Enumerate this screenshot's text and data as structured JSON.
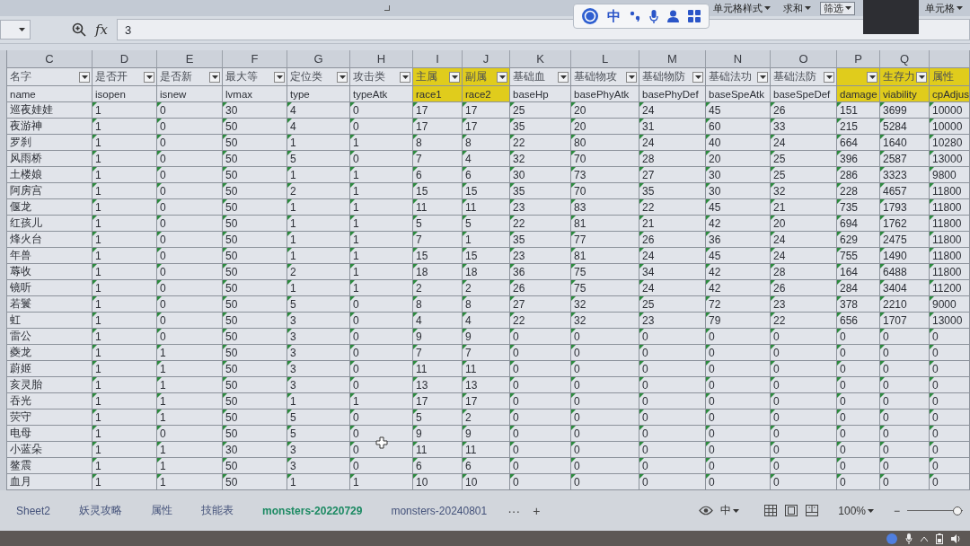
{
  "ribbon": {
    "buttons": [
      {
        "label": "单元格样式",
        "on": false
      },
      {
        "label": "求和",
        "on": false
      },
      {
        "label": "筛选",
        "on": true
      },
      {
        "label": "单元格",
        "on": false
      }
    ]
  },
  "ime_toolbar": {
    "mode": "中"
  },
  "formula_bar": {
    "fx": "fx",
    "value": "3"
  },
  "columns": [
    {
      "letter": "C",
      "title": "名字",
      "field": "name",
      "filter": true,
      "highlight": false,
      "number_as_text": false
    },
    {
      "letter": "D",
      "title": "是否开",
      "field": "isopen",
      "filter": true,
      "highlight": false,
      "number_as_text": true
    },
    {
      "letter": "E",
      "title": "是否新",
      "field": "isnew",
      "filter": true,
      "highlight": false,
      "number_as_text": true
    },
    {
      "letter": "F",
      "title": "最大等",
      "field": "lvmax",
      "filter": true,
      "highlight": false,
      "number_as_text": true
    },
    {
      "letter": "G",
      "title": "定位类",
      "field": "type",
      "filter": true,
      "highlight": false,
      "number_as_text": true
    },
    {
      "letter": "H",
      "title": "攻击类",
      "field": "typeAtk",
      "filter": true,
      "highlight": false,
      "number_as_text": true
    },
    {
      "letter": "I",
      "title": "主属",
      "field": "race1",
      "filter": true,
      "highlight": true,
      "number_as_text": true
    },
    {
      "letter": "J",
      "title": "副属",
      "field": "race2",
      "filter": true,
      "highlight": true,
      "number_as_text": true
    },
    {
      "letter": "K",
      "title": "基础血",
      "field": "baseHp",
      "filter": true,
      "highlight": false,
      "number_as_text": true
    },
    {
      "letter": "L",
      "title": "基础物攻",
      "field": "basePhyAtk",
      "filter": true,
      "highlight": false,
      "number_as_text": true
    },
    {
      "letter": "M",
      "title": "基础物防",
      "field": "basePhyDef",
      "filter": true,
      "highlight": false,
      "number_as_text": true
    },
    {
      "letter": "N",
      "title": "基础法功",
      "field": "baseSpeAtk",
      "filter": true,
      "highlight": false,
      "number_as_text": true
    },
    {
      "letter": "O",
      "title": "基础法防",
      "field": "baseSpeDef",
      "filter": true,
      "highlight": false,
      "number_as_text": true
    },
    {
      "letter": "P",
      "field": "damage",
      "filter": true,
      "highlight": true,
      "number_as_text": true
    },
    {
      "letter": "Q",
      "title": "生存力",
      "field": "viability",
      "filter": true,
      "highlight": true,
      "number_as_text": true
    },
    {
      "title": "属性",
      "field": "cpAdjus",
      "filter": false,
      "highlight": true,
      "number_as_text": true
    }
  ],
  "rows": [
    [
      "巡夜娃娃",
      "1",
      "0",
      "30",
      "4",
      "0",
      "17",
      "17",
      "25",
      "20",
      "24",
      "45",
      "26",
      "151",
      "3699",
      "10000"
    ],
    [
      "夜游神",
      "1",
      "0",
      "50",
      "4",
      "0",
      "17",
      "17",
      "35",
      "20",
      "31",
      "60",
      "33",
      "215",
      "5284",
      "10000"
    ],
    [
      "罗刹",
      "1",
      "0",
      "50",
      "1",
      "1",
      "8",
      "8",
      "22",
      "80",
      "24",
      "40",
      "24",
      "664",
      "1640",
      "10280"
    ],
    [
      "风雨桥",
      "1",
      "0",
      "50",
      "5",
      "0",
      "7",
      "4",
      "32",
      "70",
      "28",
      "20",
      "25",
      "396",
      "2587",
      "13000"
    ],
    [
      "土楼娘",
      "1",
      "0",
      "50",
      "1",
      "1",
      "6",
      "6",
      "30",
      "73",
      "27",
      "30",
      "25",
      "286",
      "3323",
      "9800"
    ],
    [
      "阿房宫",
      "1",
      "0",
      "50",
      "2",
      "1",
      "15",
      "15",
      "35",
      "70",
      "35",
      "30",
      "32",
      "228",
      "4657",
      "11800"
    ],
    [
      "偃龙",
      "1",
      "0",
      "50",
      "1",
      "1",
      "11",
      "11",
      "23",
      "83",
      "22",
      "45",
      "21",
      "735",
      "1793",
      "11800"
    ],
    [
      "红孩儿",
      "1",
      "0",
      "50",
      "1",
      "1",
      "5",
      "5",
      "22",
      "81",
      "21",
      "42",
      "20",
      "694",
      "1762",
      "11800"
    ],
    [
      "烽火台",
      "1",
      "0",
      "50",
      "1",
      "1",
      "7",
      "1",
      "35",
      "77",
      "26",
      "36",
      "24",
      "629",
      "2475",
      "11800"
    ],
    [
      "年兽",
      "1",
      "0",
      "50",
      "1",
      "1",
      "15",
      "15",
      "23",
      "81",
      "24",
      "45",
      "24",
      "755",
      "1490",
      "11800"
    ],
    [
      "蓐收",
      "1",
      "0",
      "50",
      "2",
      "1",
      "18",
      "18",
      "36",
      "75",
      "34",
      "42",
      "28",
      "164",
      "6488",
      "11800"
    ],
    [
      "镜听",
      "1",
      "0",
      "50",
      "1",
      "1",
      "2",
      "2",
      "26",
      "75",
      "24",
      "42",
      "26",
      "284",
      "3404",
      "11200"
    ],
    [
      "若鬟",
      "1",
      "0",
      "50",
      "5",
      "0",
      "8",
      "8",
      "27",
      "32",
      "25",
      "72",
      "23",
      "378",
      "2210",
      "9000"
    ],
    [
      "虹",
      "1",
      "0",
      "50",
      "3",
      "0",
      "4",
      "4",
      "22",
      "32",
      "23",
      "79",
      "22",
      "656",
      "1707",
      "13000"
    ],
    [
      "雷公",
      "1",
      "0",
      "50",
      "3",
      "0",
      "9",
      "9",
      "0",
      "0",
      "0",
      "0",
      "0",
      "0",
      "0",
      "0"
    ],
    [
      "夔龙",
      "1",
      "1",
      "50",
      "3",
      "0",
      "7",
      "7",
      "0",
      "0",
      "0",
      "0",
      "0",
      "0",
      "0",
      "0"
    ],
    [
      "蔚姬",
      "1",
      "1",
      "50",
      "3",
      "0",
      "11",
      "11",
      "0",
      "0",
      "0",
      "0",
      "0",
      "0",
      "0",
      "0"
    ],
    [
      "亥灵胎",
      "1",
      "1",
      "50",
      "3",
      "0",
      "13",
      "13",
      "0",
      "0",
      "0",
      "0",
      "0",
      "0",
      "0",
      "0"
    ],
    [
      "吞光",
      "1",
      "1",
      "50",
      "1",
      "1",
      "17",
      "17",
      "0",
      "0",
      "0",
      "0",
      "0",
      "0",
      "0",
      "0"
    ],
    [
      "荧守",
      "1",
      "1",
      "50",
      "5",
      "0",
      "5",
      "2",
      "0",
      "0",
      "0",
      "0",
      "0",
      "0",
      "0",
      "0"
    ],
    [
      "电母",
      "1",
      "0",
      "50",
      "5",
      "0",
      "9",
      "9",
      "0",
      "0",
      "0",
      "0",
      "0",
      "0",
      "0",
      "0"
    ],
    [
      "小蓝朵",
      "1",
      "1",
      "30",
      "3",
      "0",
      "11",
      "11",
      "0",
      "0",
      "0",
      "0",
      "0",
      "0",
      "0",
      "0"
    ],
    [
      "鳌震",
      "1",
      "1",
      "50",
      "3",
      "0",
      "6",
      "6",
      "0",
      "0",
      "0",
      "0",
      "0",
      "0",
      "0",
      "0"
    ],
    [
      "血月",
      "1",
      "1",
      "50",
      "1",
      "1",
      "10",
      "10",
      "0",
      "0",
      "0",
      "0",
      "0",
      "0",
      "0",
      "0"
    ]
  ],
  "sheet_tabs": [
    {
      "label": "Sheet2",
      "selected": false
    },
    {
      "label": "妖灵攻略",
      "selected": false
    },
    {
      "label": "属性",
      "selected": false
    },
    {
      "label": "技能表",
      "selected": false
    },
    {
      "label": "monsters-20220729",
      "selected": true
    },
    {
      "label": "monsters-20240801",
      "selected": false
    }
  ],
  "tab_controls": {
    "more": "···",
    "add": "+"
  },
  "status_bar": {
    "input_mode": "中",
    "zoom": "100%",
    "zoom_out": "−",
    "zoom_slider": {
      "level": 0.9
    }
  }
}
